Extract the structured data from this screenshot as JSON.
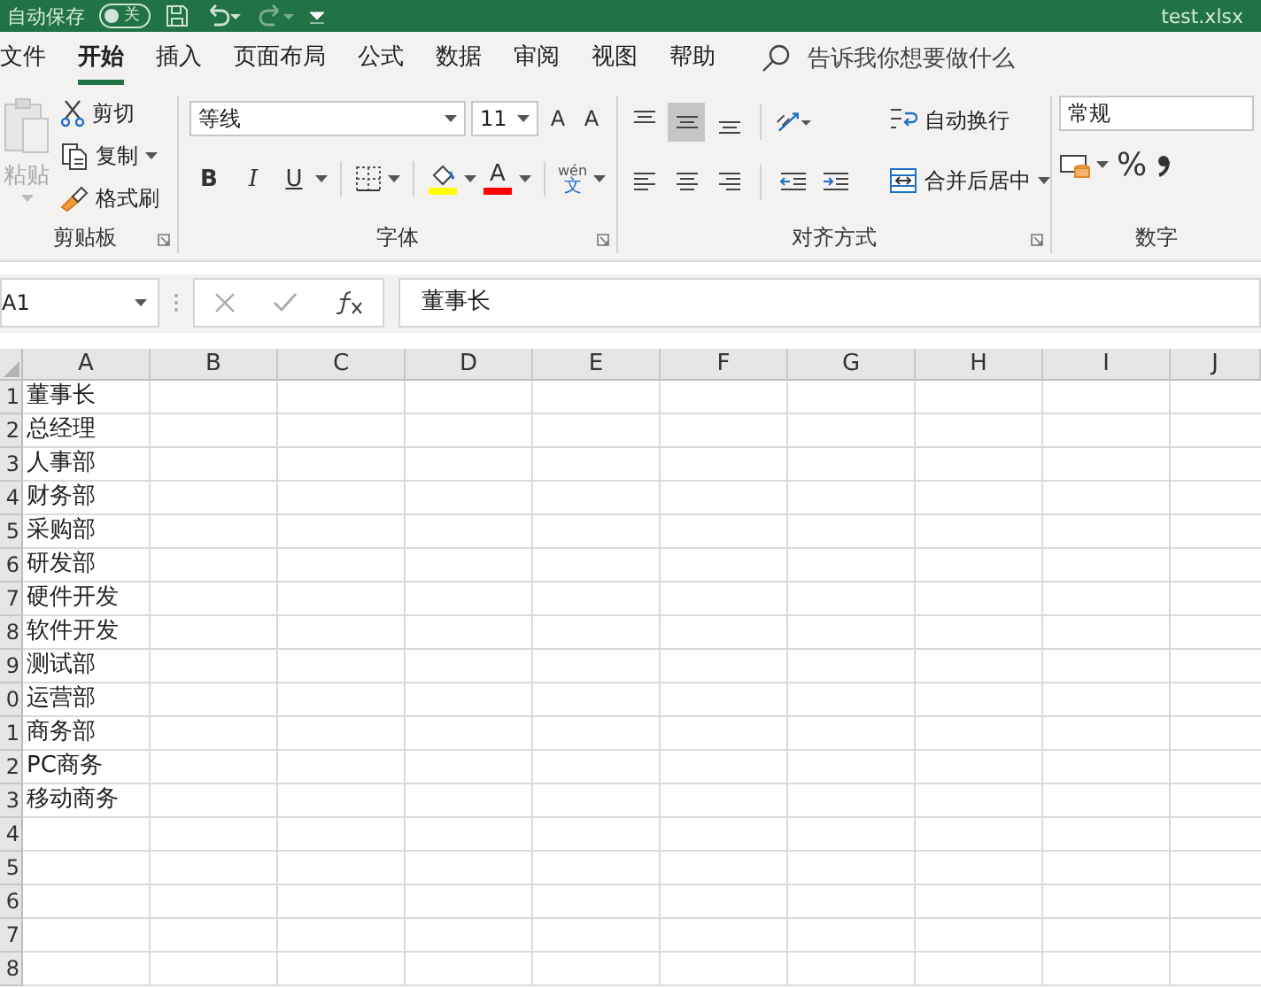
{
  "title_bar": {
    "autosave_label": "自动保存",
    "autosave_toggle": {
      "label": "关",
      "on": false
    },
    "filename": "test.xlsx"
  },
  "tabs": [
    {
      "label": "文件",
      "selected": false
    },
    {
      "label": "开始",
      "selected": true
    },
    {
      "label": "插入",
      "selected": false
    },
    {
      "label": "页面布局",
      "selected": false
    },
    {
      "label": "公式",
      "selected": false
    },
    {
      "label": "数据",
      "selected": false
    },
    {
      "label": "审阅",
      "selected": false
    },
    {
      "label": "视图",
      "selected": false
    },
    {
      "label": "帮助",
      "selected": false
    }
  ],
  "tell_me": {
    "placeholder": "告诉我你想要做什么"
  },
  "clipboard": {
    "paste": "粘贴",
    "cut": "剪切",
    "copy": "复制",
    "format_painter": "格式刷",
    "label": "剪贴板"
  },
  "font": {
    "font_name": "等线",
    "font_size": "11",
    "grow": "A",
    "shrink": "A",
    "bold": "B",
    "italic": "I",
    "underline": "U",
    "font_color_letter": "A",
    "phonetic_top": "wén",
    "phonetic_bottom": "文",
    "label": "字体"
  },
  "alignment": {
    "vertical": [
      {
        "selected": false
      },
      {
        "selected": true
      },
      {
        "selected": false
      }
    ],
    "horizontal": [
      {
        "selected": false
      },
      {
        "selected": false
      },
      {
        "selected": false
      }
    ],
    "wrap_text": "自动换行",
    "merge_center": "合并后居中",
    "label": "对齐方式"
  },
  "number": {
    "format": "常规",
    "percent": "%",
    "label": "数字"
  },
  "formula_bar": {
    "name_box": "A1",
    "value": "董事长"
  },
  "sheet": {
    "columns": [
      "A",
      "B",
      "C",
      "D",
      "E",
      "F",
      "G",
      "H",
      "I",
      "J"
    ],
    "rows": [
      {
        "number": "1",
        "cell": "董事长"
      },
      {
        "number": "2",
        "cell": "总经理"
      },
      {
        "number": "3",
        "cell": "人事部"
      },
      {
        "number": "4",
        "cell": "财务部"
      },
      {
        "number": "5",
        "cell": "采购部"
      },
      {
        "number": "6",
        "cell": "研发部"
      },
      {
        "number": "7",
        "cell": "硬件开发"
      },
      {
        "number": "8",
        "cell": "软件开发"
      },
      {
        "number": "9",
        "cell": "测试部"
      },
      {
        "number": "0",
        "cell": "运营部"
      },
      {
        "number": "1",
        "cell": "商务部"
      },
      {
        "number": "2",
        "cell": "PC商务"
      },
      {
        "number": "3",
        "cell": "移动商务"
      },
      {
        "number": "4",
        "cell": ""
      },
      {
        "number": "5",
        "cell": ""
      },
      {
        "number": "6",
        "cell": ""
      },
      {
        "number": "7",
        "cell": ""
      },
      {
        "number": "8",
        "cell": ""
      }
    ]
  }
}
